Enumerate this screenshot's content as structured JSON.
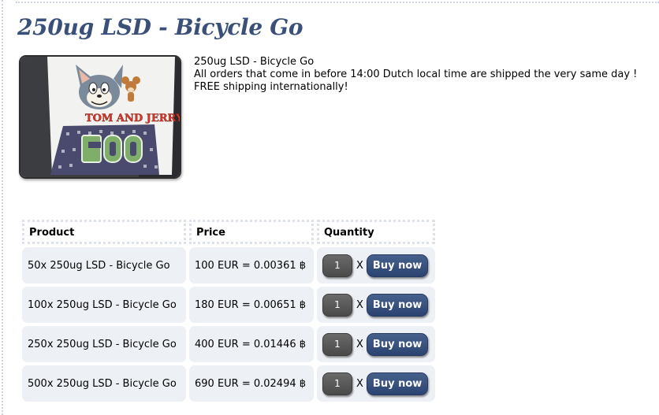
{
  "page": {
    "title": "250ug LSD - Bicycle Go"
  },
  "product": {
    "image_alt": "Tom and Jerry blotter sheet",
    "image_text": "TOM AND JERRY",
    "description": [
      "250ug LSD - Bicycle Go",
      "All orders that come in before 14:00 Dutch local time are shipped the very same day !",
      "FREE shipping internationally!"
    ]
  },
  "table": {
    "headers": {
      "product": "Product",
      "price": "Price",
      "quantity": "Quantity"
    },
    "rows": [
      {
        "product": "50x 250ug LSD - Bicycle Go",
        "price": "100 EUR = 0.00361 ฿",
        "quantity": "1",
        "times": "X",
        "buy_label": "Buy now"
      },
      {
        "product": "100x 250ug LSD - Bicycle Go",
        "price": "180 EUR = 0.00651 ฿",
        "quantity": "1",
        "times": "X",
        "buy_label": "Buy now"
      },
      {
        "product": "250x 250ug LSD - Bicycle Go",
        "price": "400 EUR = 0.01446 ฿",
        "quantity": "1",
        "times": "X",
        "buy_label": "Buy now"
      },
      {
        "product": "500x 250ug LSD - Bicycle Go",
        "price": "690 EUR = 0.02494 ฿",
        "quantity": "1",
        "times": "X",
        "buy_label": "Buy now"
      }
    ]
  },
  "colors": {
    "title": "#3a5078",
    "button": "#2c4370",
    "cell_bg": "#edf0f5"
  }
}
